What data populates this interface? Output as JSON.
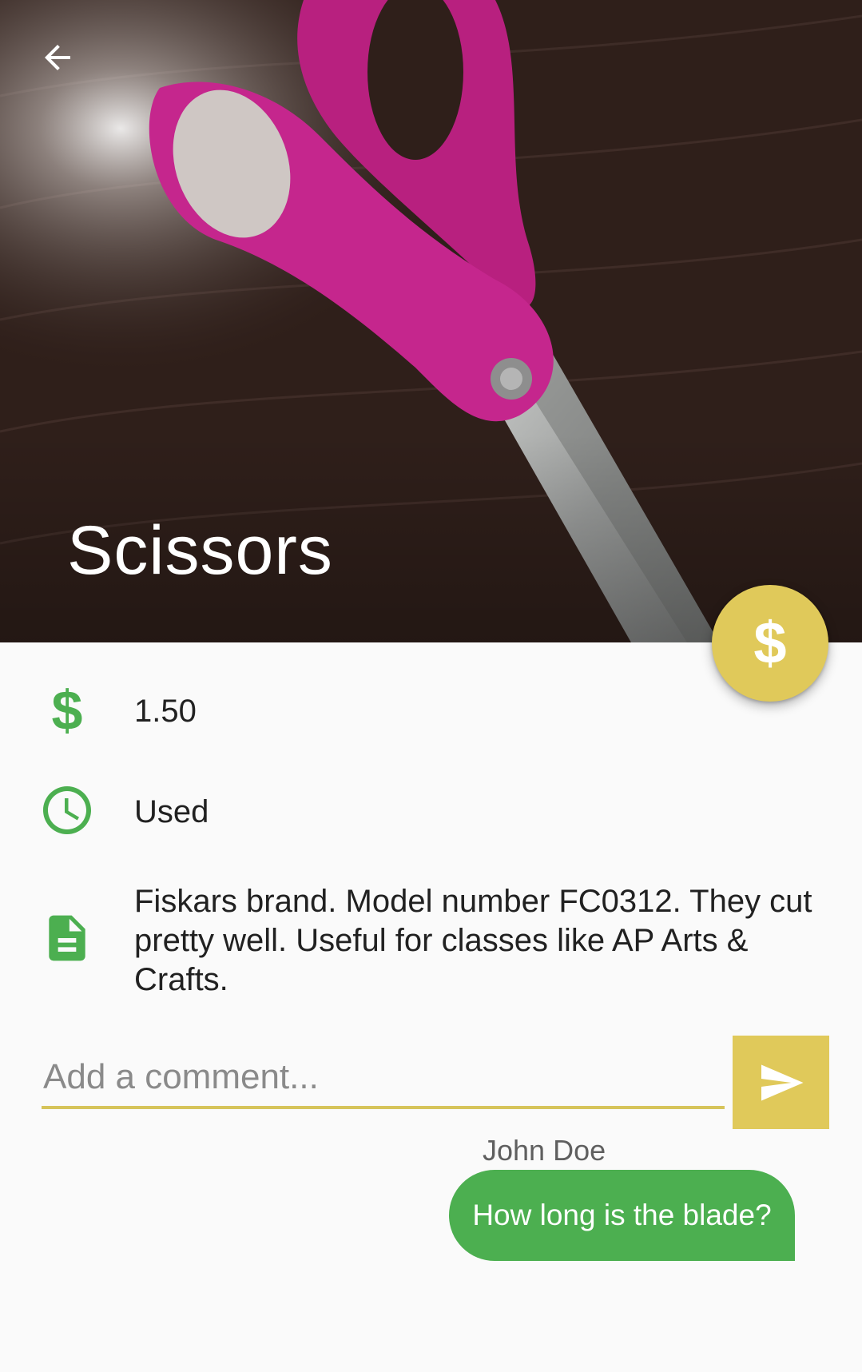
{
  "item": {
    "title": "Scissors",
    "price": "1.50",
    "condition": "Used",
    "description": "Fiskars brand. Model number FC0312. They cut pretty well. Useful for classes like AP Arts & Crafts."
  },
  "icons": {
    "back": "arrow-back-icon",
    "fab": "dollar-icon",
    "price": "dollar-icon",
    "condition": "clock-icon",
    "description": "document-icon",
    "send": "send-icon"
  },
  "fab": {
    "glyph": "$"
  },
  "price_icon_glyph": "$",
  "comment_form": {
    "placeholder": "Add a comment...",
    "value": ""
  },
  "comments": [
    {
      "author": "John Doe",
      "text": "How long is the blade?"
    }
  ],
  "colors": {
    "accent_yellow": "#e0c95a",
    "accent_green": "#4caf50",
    "background": "#fafafa"
  }
}
